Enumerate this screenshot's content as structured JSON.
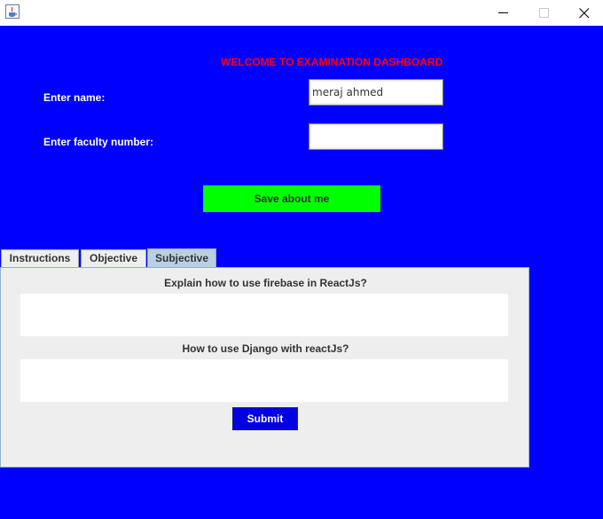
{
  "window": {
    "icon": "java-icon",
    "controls": [
      "minimize-icon",
      "maximize-icon",
      "close-icon"
    ]
  },
  "header": {
    "welcome_text": "WELCOME TO EXAMINATION DASHBOARD"
  },
  "form": {
    "name_label": "Enter name:",
    "name_value": "meraj ahmed",
    "faculty_label": "Enter faculty number:",
    "faculty_value": "",
    "save_label": "Save about me"
  },
  "tabs": [
    {
      "label": "Instructions",
      "selected": false
    },
    {
      "label": "Objective",
      "selected": false
    },
    {
      "label": "Subjective",
      "selected": true
    }
  ],
  "subjective": {
    "questions": [
      {
        "text": "Explain how to use firebase in ReactJs?",
        "answer": ""
      },
      {
        "text": "How to use Django with reactJs?",
        "answer": ""
      }
    ],
    "submit_label": "Submit"
  },
  "colors": {
    "background": "#0000ff",
    "welcome": "#ff0000",
    "save_button": "#00ff00",
    "submit_button": "#0000e0",
    "selected_tab": "#b8cfe5"
  }
}
